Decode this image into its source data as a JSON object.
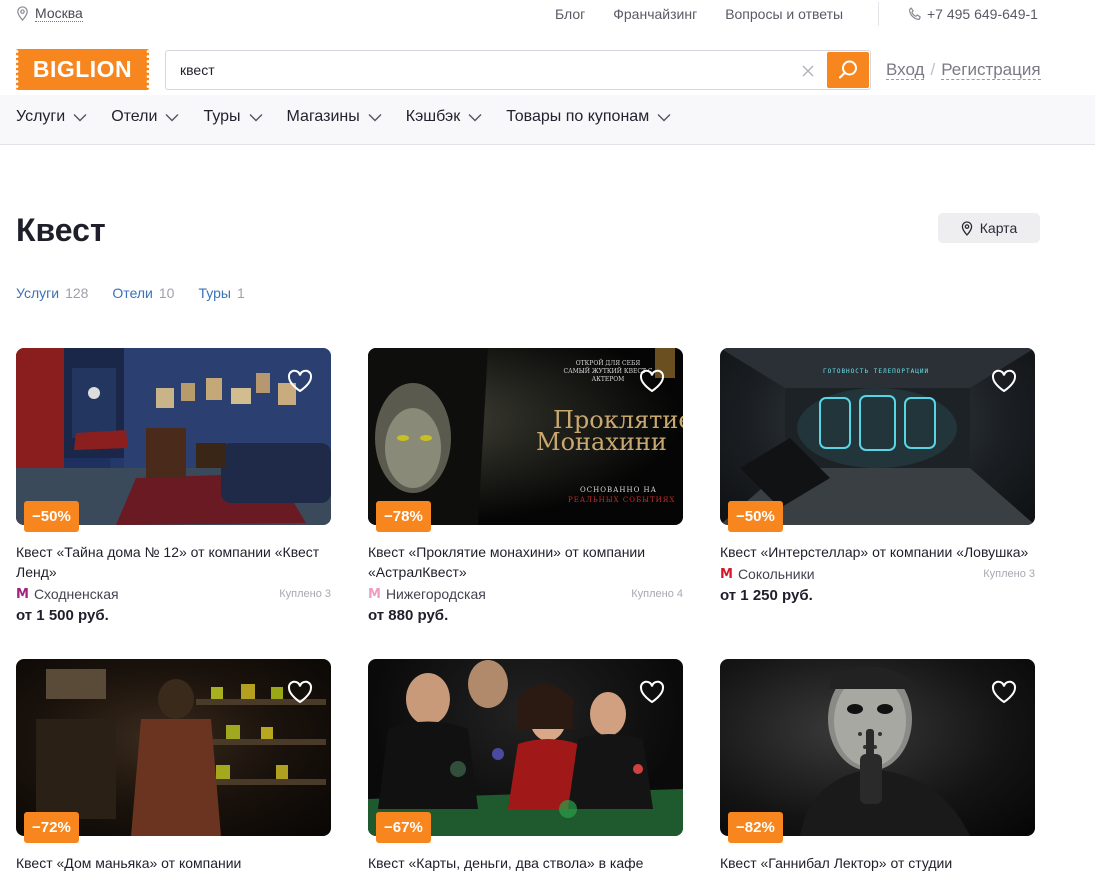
{
  "topbar": {
    "city": "Москва",
    "links": [
      "Блог",
      "Франчайзинг",
      "Вопросы и ответы"
    ],
    "phone": "+7 495 649-649-1"
  },
  "header": {
    "logo": "BIGLION",
    "search_value": "квест",
    "login": "Вход",
    "auth_separator": "/",
    "register": "Регистрация"
  },
  "nav": [
    "Услуги",
    "Отели",
    "Туры",
    "Магазины",
    "Кэшбэк",
    "Товары по купонам"
  ],
  "page": {
    "title": "Квест",
    "map_button": "Карта",
    "categories": [
      {
        "name": "Услуги",
        "count": "128"
      },
      {
        "name": "Отели",
        "count": "10"
      },
      {
        "name": "Туры",
        "count": "1"
      }
    ]
  },
  "colors": {
    "accent": "#f7861e",
    "link": "#3a72b8",
    "metro_red": "#d6182a",
    "metro_pink": "#ef9dc0"
  },
  "cards": [
    {
      "discount": "−50%",
      "title": "Квест «Тайна дома № 12» от компании «Квест Ленд»",
      "metro": "Сходненская",
      "metro_color": "#a4217f",
      "bought": "Куплено 3",
      "price": "от 1 500 руб."
    },
    {
      "discount": "−78%",
      "title": "Квест «Проклятие монахини» от компании «АстралКвест»",
      "metro": "Нижегородская",
      "metro_color": "#ef9dc0",
      "bought": "Куплено 4",
      "price": "от 880 руб.",
      "image_text": {
        "top": "ОТКРОЙ ДЛЯ СЕБЯ САМЫЙ ЖУТКИЙ КВЕСТ С АКТЕРОМ",
        "main_1": "Проклятие",
        "main_2": "Монахини",
        "bottom_1": "ОСНОВАННО НА",
        "bottom_2": "РЕАЛЬНЫХ СОБЫТИЯХ"
      }
    },
    {
      "discount": "−50%",
      "title": "Квест «Интерстеллар» от компании «Ловушка»",
      "metro": "Сокольники",
      "metro_color": "#d6182a",
      "bought": "Куплено 3",
      "price": "от 1 250 руб.",
      "image_text": {
        "top": "ГОТОВНОСТЬ ТЕЛЕПОРТАЦИИ"
      }
    },
    {
      "discount": "−72%",
      "title": "Квест «Дом маньяка» от компании"
    },
    {
      "discount": "−67%",
      "title": "Квест «Карты, деньги, два ствола» в кафе"
    },
    {
      "discount": "−82%",
      "title": "Квест «Ганнибал Лектор» от студии"
    }
  ]
}
